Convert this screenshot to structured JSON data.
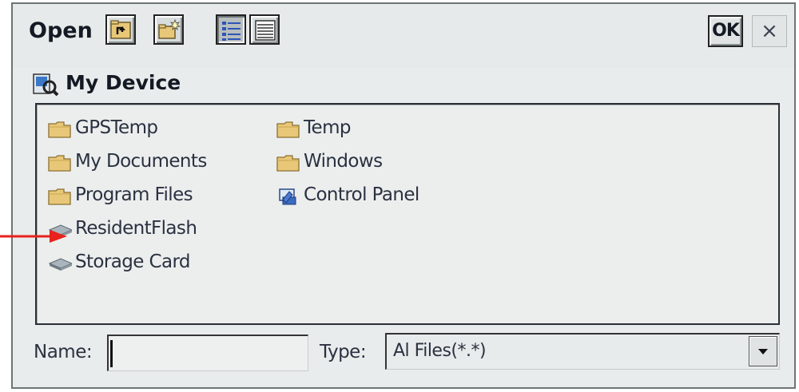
{
  "window": {
    "title": "Open",
    "ok_label": "OK",
    "close_label": "×"
  },
  "toolbar": {
    "buttons": [
      {
        "icon": "up-folder-icon"
      },
      {
        "icon": "new-folder-icon"
      },
      {
        "icon": "list-view-icon"
      },
      {
        "icon": "details-view-icon"
      }
    ]
  },
  "location": {
    "label": "My Device",
    "icon": "my-device-icon"
  },
  "files": [
    {
      "label": "GPSTemp",
      "icon": "folder-icon"
    },
    {
      "label": "My Documents",
      "icon": "folder-icon"
    },
    {
      "label": "Program Files",
      "icon": "folder-icon"
    },
    {
      "label": "ResidentFlash",
      "icon": "storage-card-icon"
    },
    {
      "label": "Storage Card",
      "icon": "storage-card-icon"
    },
    {
      "label": "Temp",
      "icon": "folder-icon"
    },
    {
      "label": "Windows",
      "icon": "folder-icon"
    },
    {
      "label": "Control Panel",
      "icon": "control-panel-icon"
    }
  ],
  "footer": {
    "name_label": "Name:",
    "name_value": "",
    "type_label": "Type:",
    "type_value": "Al Files(*.*)"
  },
  "colors": {
    "folder": "#e8c878",
    "annotation_arrow": "#e8221c"
  }
}
